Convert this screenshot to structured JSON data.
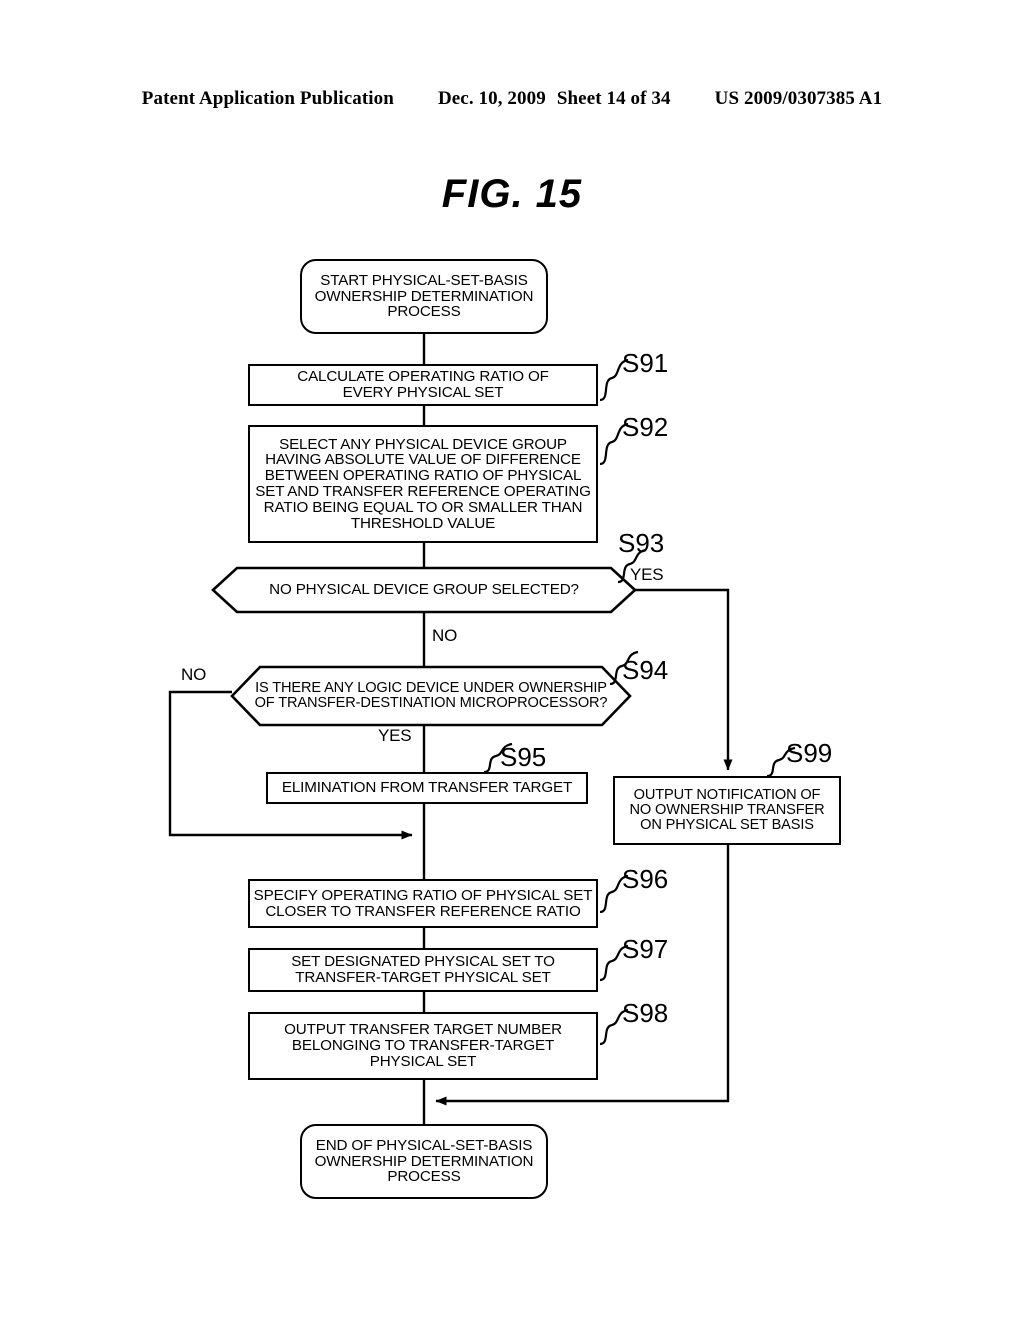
{
  "header": {
    "publication": "Patent Application Publication",
    "date": "Dec. 10, 2009",
    "sheet": "Sheet 14 of 34",
    "number": "US 2009/0307385 A1"
  },
  "figure": {
    "title": "FIG. 15"
  },
  "flowchart": {
    "nodes": {
      "start": {
        "label": "START PHYSICAL-SET-BASIS\nOWNERSHIP DETERMINATION\nPROCESS",
        "shape": "terminator"
      },
      "s91": {
        "step": "S91",
        "label": "CALCULATE OPERATING RATIO OF\nEVERY PHYSICAL SET",
        "shape": "process"
      },
      "s92": {
        "step": "S92",
        "label": "SELECT ANY PHYSICAL DEVICE GROUP\nHAVING ABSOLUTE VALUE OF DIFFERENCE\nBETWEEN OPERATING RATIO OF PHYSICAL\nSET AND TRANSFER REFERENCE OPERATING\nRATIO BEING EQUAL TO OR SMALLER THAN\nTHRESHOLD VALUE",
        "shape": "process"
      },
      "s93": {
        "step": "S93",
        "label": "NO PHYSICAL DEVICE GROUP SELECTED?",
        "shape": "decision",
        "yes_label": "YES",
        "no_label": "NO"
      },
      "s94": {
        "step": "S94",
        "label": "IS THERE ANY LOGIC DEVICE UNDER OWNERSHIP\nOF TRANSFER-DESTINATION MICROPROCESSOR?",
        "shape": "decision",
        "yes_label": "YES",
        "no_label": "NO"
      },
      "s95": {
        "step": "S95",
        "label": "ELIMINATION FROM TRANSFER TARGET",
        "shape": "process"
      },
      "s96": {
        "step": "S96",
        "label": "SPECIFY OPERATING RATIO OF PHYSICAL SET\nCLOSER TO TRANSFER REFERENCE RATIO",
        "shape": "process"
      },
      "s97": {
        "step": "S97",
        "label": "SET DESIGNATED PHYSICAL SET TO\nTRANSFER-TARGET PHYSICAL SET",
        "shape": "process"
      },
      "s98": {
        "step": "S98",
        "label": "OUTPUT TRANSFER TARGET NUMBER\nBELONGING TO TRANSFER-TARGET\nPHYSICAL SET",
        "shape": "process"
      },
      "s99": {
        "step": "S99",
        "label": "OUTPUT NOTIFICATION OF\nNO OWNERSHIP TRANSFER\nON PHYSICAL SET BASIS",
        "shape": "process"
      },
      "end": {
        "label": "END OF PHYSICAL-SET-BASIS\nOWNERSHIP DETERMINATION\nPROCESS",
        "shape": "terminator"
      }
    },
    "colors": {
      "line": "#000000",
      "fill": "#ffffff"
    }
  }
}
